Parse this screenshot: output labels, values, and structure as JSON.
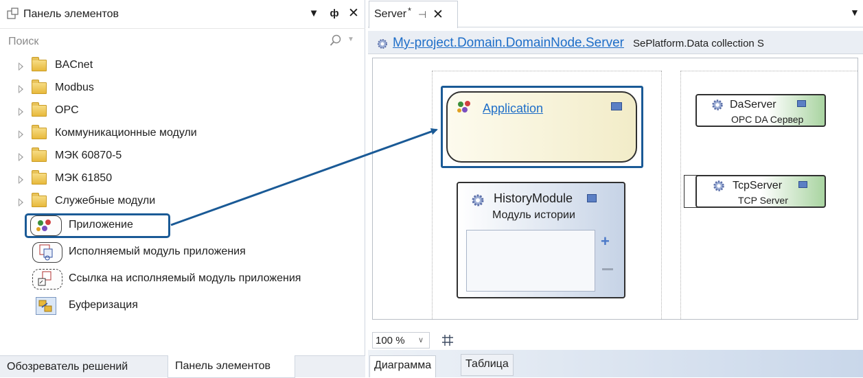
{
  "toolbox": {
    "title": "Панель элементов",
    "search_placeholder": "Поиск",
    "folders": [
      {
        "label": "BACnet"
      },
      {
        "label": "Modbus"
      },
      {
        "label": "OPC"
      },
      {
        "label": "Коммуникационные модули"
      },
      {
        "label": "МЭК 60870-5"
      },
      {
        "label": "МЭК 61850"
      },
      {
        "label": "Служебные модули"
      }
    ],
    "tools": [
      {
        "label": "Приложение"
      },
      {
        "label": "Исполняемый модуль приложения"
      },
      {
        "label": "Ссылка на исполняемый модуль приложения"
      },
      {
        "label": "Буферизация"
      }
    ],
    "bottom_tabs": [
      "Обозреватель решений",
      "Панель элементов"
    ]
  },
  "document": {
    "tab_label": "Server",
    "tab_modified": "*",
    "breadcrumb_link": "My-project.Domain.DomainNode.",
    "breadcrumb_current": "Server",
    "breadcrumb_type": "SePlatform.Data collection S",
    "zoom": "100 %",
    "view_tabs": [
      "Диаграмма",
      "Таблица"
    ]
  },
  "diagram": {
    "application": {
      "name": "Application"
    },
    "history_module": {
      "name": "HistoryModule",
      "subtitle": "Модуль истории"
    },
    "da_server": {
      "name": "DaServer",
      "subtitle": "OPC DA Сервер"
    },
    "tcp_server": {
      "name": "TcpServer",
      "subtitle": "TCP Server"
    }
  },
  "colors": {
    "highlight_border": "#1a5a96",
    "link": "#1e6ec8",
    "application_fill": "#f7f3d8",
    "history_fill": "#c6d3e6",
    "server_fill": "#a9d4a1"
  }
}
